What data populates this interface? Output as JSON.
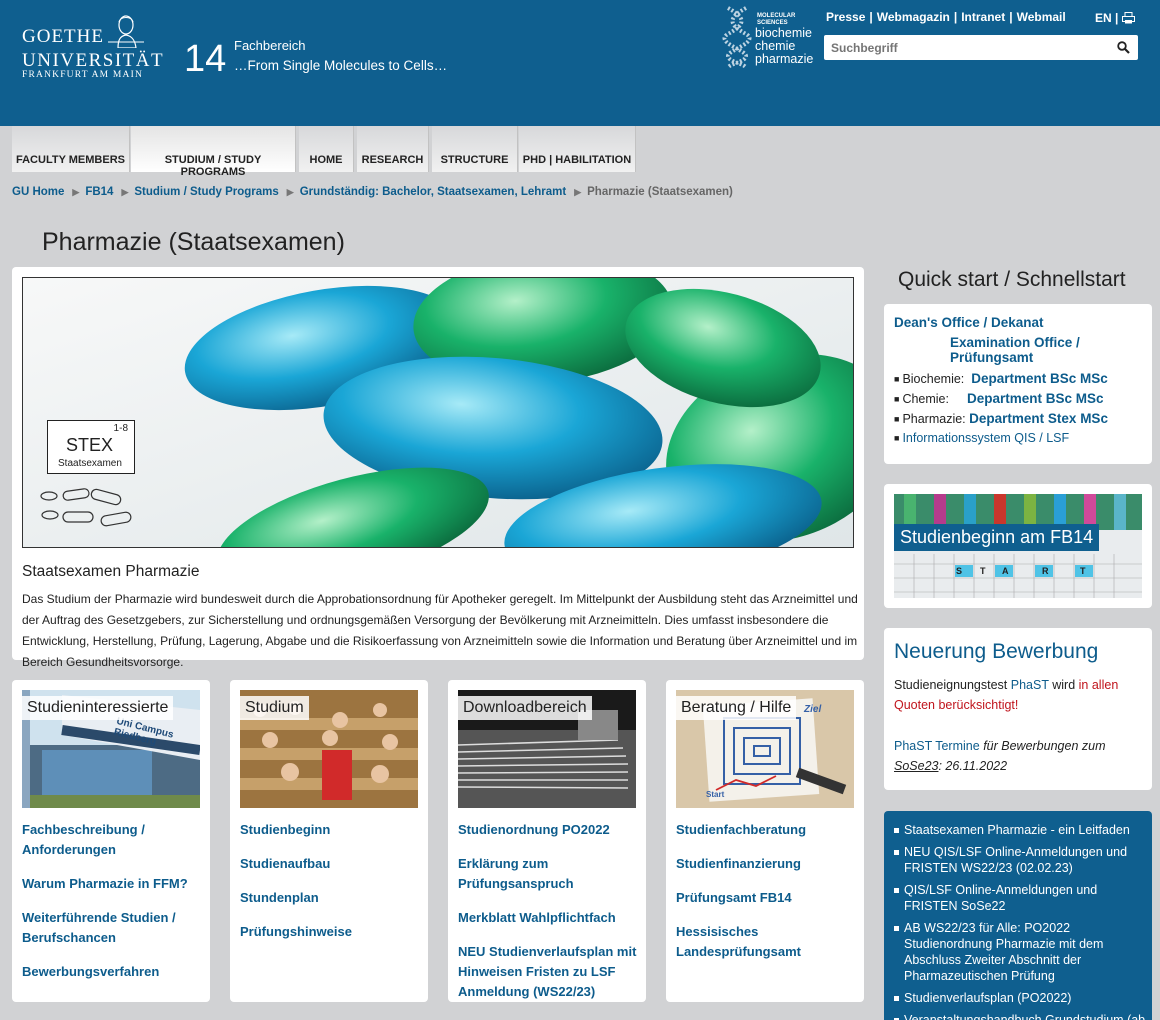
{
  "header": {
    "logo": {
      "line1": "GOETHE",
      "line2": "UNIVERSITÄT",
      "line3": "FRANKFURT AM MAIN"
    },
    "fb_number": "14",
    "fb_label": "Fachbereich",
    "fb_slogan": "…From Single Molecules to Cells…",
    "molecular_logo": {
      "small": "MOLECULAR SCIENCES",
      "words": [
        "biochemie",
        "chemie",
        "pharmazie"
      ]
    },
    "top_links": [
      "Presse",
      "Webmagazin",
      "Intranet",
      "Webmail"
    ],
    "lang": "EN",
    "search_placeholder": "Suchbegriff"
  },
  "nav": [
    "FACULTY MEMBERS",
    "STUDIUM / STUDY PROGRAMS",
    "HOME",
    "RESEARCH",
    "STRUCTURE",
    "PHD | HABILITATION"
  ],
  "breadcrumb": [
    "GU Home",
    "FB14",
    "Studium / Study Programs",
    "Grundständig: Bachelor, Staatsexamen, Lehramt",
    "Pharmazie (Staatsexamen)"
  ],
  "page_title": "Pharmazie (Staatsexamen)",
  "hero": {
    "stex_label": "STEX",
    "stex_sup": "1-8",
    "stex_sub": "Staatsexamen",
    "subtitle": "Staatsexamen Pharmazie",
    "text": "Das Studium der Pharmazie wird bundesweit durch die Approbationsordnung für Apotheker geregelt. Im Mittelpunkt der Ausbildung steht das Arzneimittel und der Auftrag des Gesetzgebers, zur Sicherstellung und ordnungsgemäßen Versorgung der Bevölkerung mit Arzneimitteln. Dies umfasst insbesondere die Entwicklung, Herstellung, Prüfung, Lagerung, Abgabe und die Risikoerfassung von Arzneimitteln sowie die Information und Beratung über Arzneimittel und im Bereich Gesundheitsvorsorge."
  },
  "tiles": [
    {
      "label": "Studieninteressierte",
      "img_text": "Uni Campus Riedberg",
      "links": [
        "Fachbeschreibung / Anforderungen",
        "Warum Pharmazie in FFM?",
        "Weiterführende Studien / Berufschancen",
        "Bewerbungsverfahren"
      ]
    },
    {
      "label": "Studium",
      "links": [
        "Studienbeginn",
        "Studienaufbau",
        "Stundenplan",
        "Prüfungshinweise"
      ]
    },
    {
      "label": "Downloadbereich",
      "links": [
        "Studienordnung PO2022",
        "Erklärung zum Prüfungsanspruch",
        "Merkblatt Wahlpflichtfach",
        "NEU Studienverlaufsplan mit Hinweisen Fristen zu LSF Anmeldung (WS22/23)"
      ]
    },
    {
      "label": "Beratung / Hilfe",
      "img_start": "Start",
      "img_ziel": "Ziel",
      "links": [
        "Studienfachberatung",
        "Studienfinanzierung",
        "Prüfungsamt FB14",
        "Hessisisches Landesprüfungsamt"
      ]
    }
  ],
  "quickstart": {
    "title": "Quick start / Schnellstart",
    "dean": "Dean's Office / Dekanat",
    "exam": "Examination Office / Prüfungsamt",
    "rows": [
      {
        "label": "Biochemie:",
        "link": "Department BSc MSc"
      },
      {
        "label": "Chemie:",
        "link": "Department BSc MSc"
      },
      {
        "label": "Pharmazie:",
        "link": "Department Stex MSc"
      }
    ],
    "qis": "Informationssystem QIS / LSF"
  },
  "banner": {
    "text": "Studienbeginn am FB14",
    "tiles": [
      "S",
      "T",
      "A",
      "R",
      "T"
    ]
  },
  "neuerung": {
    "title": "Neuerung Bewerbung",
    "p1_a": "Studieneignungstest",
    "p1_link": "PhaST",
    "p1_b": "wird",
    "p1_red": "in allen Quoten berücksichtigt!",
    "p2_link": "PhaST Termine",
    "p2_a": "für Bewerbungen zum",
    "p2_u": "SoSe23",
    "p2_b": ": 26.11.2022"
  },
  "news": [
    "Staatsexamen Pharmazie - ein Leitfaden",
    "NEU QIS/LSF Online-Anmeldungen und FRISTEN WS22/23 (02.02.23)",
    "QIS/LSF Online-Anmeldungen und FRISTEN SoSe22",
    "AB WS22/23 für Alle: PO2022 Studienordnung Pharmazie mit dem Abschluss Zweiter Abschnitt der Pharmazeutischen Prüfung",
    "Studienverlaufsplan (PO2022)",
    "Veranstaltungshandbuch Grundstudium (ab"
  ]
}
